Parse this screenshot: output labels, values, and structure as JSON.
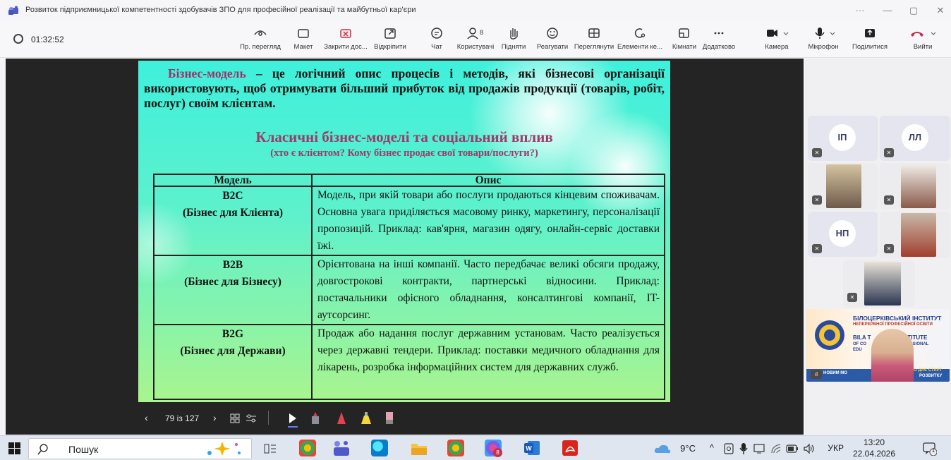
{
  "window": {
    "title": "Розвиток підприємницької компетентності здобувачів ЗПО для професійної реалізації та майбутньої кар'єри",
    "controls": [
      "···",
      "—",
      "▢",
      "✕"
    ]
  },
  "toolbar": {
    "time": "01:32:52",
    "buttons": [
      {
        "label": "Пр. перегляд",
        "icon": "eye-icon"
      },
      {
        "label": "Макет",
        "icon": "layout-icon"
      },
      {
        "label": "Закрити дос...",
        "icon": "stop-share-icon"
      },
      {
        "label": "Відкріпити",
        "icon": "popout-icon"
      },
      {
        "label": "Чат",
        "icon": "chat-icon"
      },
      {
        "label": "Користувачі",
        "icon": "people-icon",
        "badge": "8"
      },
      {
        "label": "Підняти",
        "icon": "raise-hand-icon"
      },
      {
        "label": "Реагувати",
        "icon": "smile-icon"
      },
      {
        "label": "Переглянути",
        "icon": "grid-icon"
      },
      {
        "label": "Елементи ке...",
        "icon": "settings-icon"
      },
      {
        "label": "Кімнати",
        "icon": "rooms-icon"
      },
      {
        "label": "Додатково",
        "icon": "more-icon"
      },
      {
        "label": "Камера",
        "icon": "camera-icon"
      },
      {
        "label": "Мікрофон",
        "icon": "microphone-icon"
      },
      {
        "label": "Поділитися",
        "icon": "share-icon"
      },
      {
        "label": "Вийти",
        "icon": "hangup-icon"
      }
    ]
  },
  "slide": {
    "intro_term": "Бізнес-модель",
    "intro_text": "– це логічний опис процесів і методів, які бізнесові організації використовують, щоб отримувати більший прибуток від продажів продукції (товарів, робіт, послуг) своїм клієнтам.",
    "heading": "Класичні бізнес-моделі та соціальний вплив",
    "subheading": "(хто є клієнтом? Кому бізнес продає свої товари/послуги?)",
    "table": {
      "headers": [
        "Модель",
        "Опис"
      ],
      "rows": [
        {
          "code": "B2C",
          "name": "(Бізнес для Клієнта)",
          "description": "Модель, при якій товари або послуги продаються кінцевим споживачам. Основна увага приділяється масовому ринку, маркетингу, персоналізації пропозицій. Приклад: кав'ярня, магазин одягу, онлайн-сервіс доставки їжі."
        },
        {
          "code": "B2B",
          "name": "(Бізнес для Бізнесу)",
          "description": "Орієнтована на інші компанії. Часто передбачає великі обсяги продажу, довгострокові контракти, партнерські відносини. Приклад: постачальники офісного обладнання, консалтингові компанії, IT-аутсорсинг."
        },
        {
          "code": "B2G",
          "name": "(Бізнес для Держави)",
          "description": "Продаж або надання послуг державним установам. Часто реалізується через державні тендери. Приклад: поставки медичного обладнання для лікарень, розробка інформаційних систем для державних служб."
        }
      ]
    }
  },
  "slide_nav": {
    "counter": "79 із 127"
  },
  "participants": [
    {
      "initials": "ІП"
    },
    {
      "initials": "ЛЛ"
    },
    {
      "initials": "НП"
    }
  ],
  "institute_banner": {
    "line1": "БІЛОЦЕРКІВСЬКИЙ ІНСТИТУТ",
    "line2": "НЕПЕРЕРВНОЇ ПРОФЕСІЙНОЇ ОСВІТИ",
    "line3": "BILA T",
    "line3b": "INSTITUTE",
    "line4": "OF CO",
    "line4b": "ROFESSIONAL",
    "line5": "EDU",
    "foot_left": "НОВИМ МО",
    "foot_right_top": "О ДАЄ СТАРТ",
    "foot_right": "РОЗВИТКУ"
  },
  "taskbar": {
    "search_placeholder": "Пошук",
    "temperature": "9°C",
    "language": "УКР",
    "time": "13:20",
    "date": "22.04.2026",
    "badge": "8",
    "notif": "1"
  },
  "colors": {
    "slide_top": "#3ff0dc",
    "slide_bottom": "#a9f58e",
    "accent_title": "#9c3a6a",
    "hangup": "#c4314b"
  }
}
